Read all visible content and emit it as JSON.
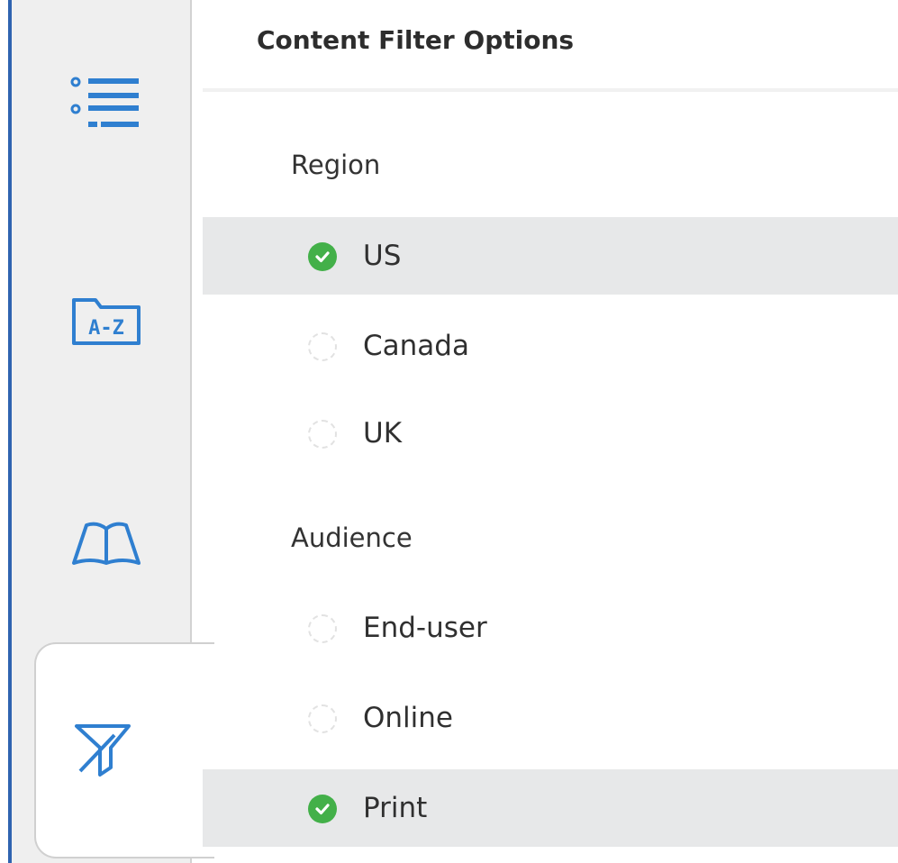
{
  "panel": {
    "title": "Content Filter Options"
  },
  "rail": {
    "items": [
      {
        "name": "table-of-contents",
        "icon": "list-icon"
      },
      {
        "name": "index",
        "icon": "folder-a-z-icon"
      },
      {
        "name": "glossary",
        "icon": "open-book-icon"
      },
      {
        "name": "filter",
        "icon": "filter-icon",
        "active": true
      }
    ]
  },
  "groups": {
    "region": {
      "title": "Region",
      "options": [
        {
          "label": "US",
          "selected": true
        },
        {
          "label": "Canada",
          "selected": false
        },
        {
          "label": "UK",
          "selected": false
        }
      ]
    },
    "audience": {
      "title": "Audience",
      "options": [
        {
          "label": "End-user",
          "selected": false
        },
        {
          "label": "Online",
          "selected": false
        },
        {
          "label": "Print",
          "selected": true
        }
      ]
    }
  },
  "colors": {
    "accent": "#2f63b0",
    "icon_blue": "#2f7fd0",
    "check_green": "#43b049",
    "selected_row": "#e7e8e9",
    "rail_bg": "#efefef"
  }
}
